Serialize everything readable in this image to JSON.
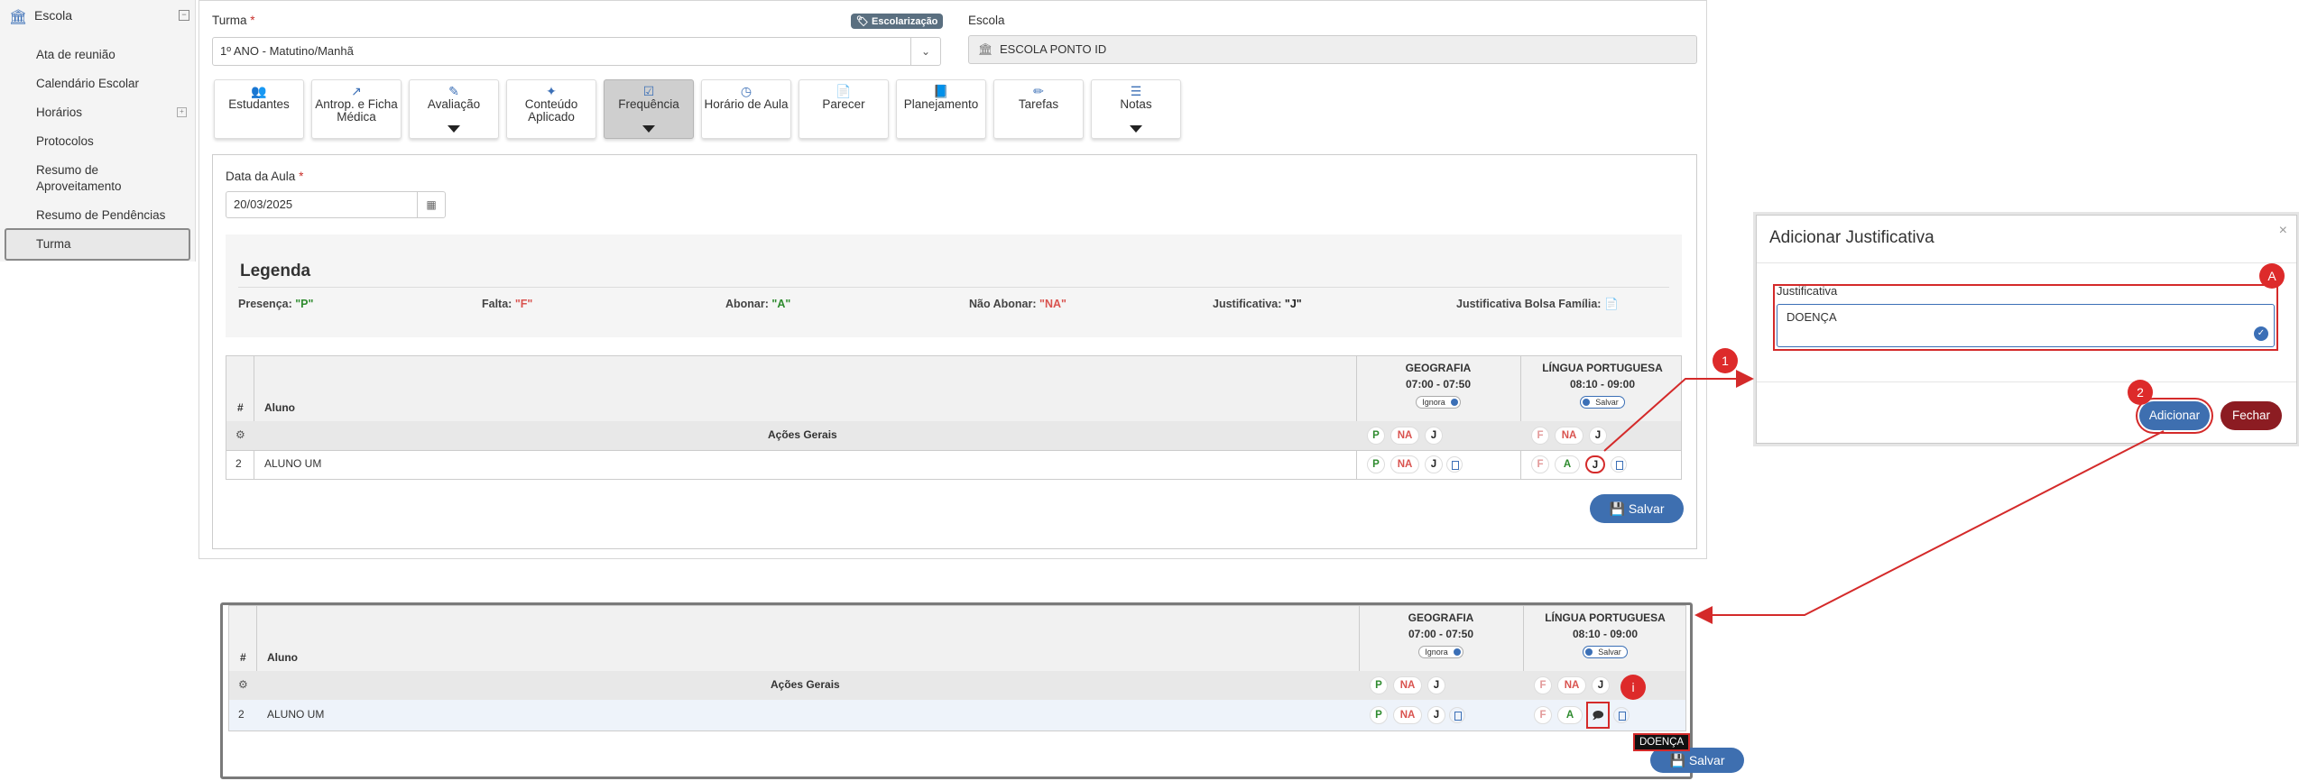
{
  "sidebar": {
    "title": "Escola",
    "items": [
      {
        "label": "Ata de reunião"
      },
      {
        "label": "Calendário Escolar"
      },
      {
        "label": "Horários"
      },
      {
        "label": "Protocolos"
      },
      {
        "label": "Resumo de Aproveitamento"
      },
      {
        "label": "Resumo de Pendências"
      },
      {
        "label": "Turma"
      }
    ]
  },
  "form": {
    "turma_label": "Turma",
    "turma_value": "1º ANO - Matutino/Manhã",
    "badge": "Escolarização",
    "escola_label": "Escola",
    "escola_value": "ESCOLA PONTO ID",
    "data_label": "Data da Aula",
    "data_value": "20/03/2025"
  },
  "tabs": [
    {
      "label": "Estudantes",
      "icon": "users-icon"
    },
    {
      "label": "Antrop. e Ficha Médica",
      "icon": "chart-line-icon"
    },
    {
      "label": "Avaliação",
      "icon": "edit-icon"
    },
    {
      "label": "Conteúdo Aplicado",
      "icon": "magic-wand-icon"
    },
    {
      "label": "Frequência",
      "icon": "check-square-icon"
    },
    {
      "label": "Horário de Aula",
      "icon": "clock-icon"
    },
    {
      "label": "Parecer",
      "icon": "file-icon"
    },
    {
      "label": "Planejamento",
      "icon": "book-icon"
    },
    {
      "label": "Tarefas",
      "icon": "pencil-icon"
    },
    {
      "label": "Notas",
      "icon": "list-icon"
    }
  ],
  "legend": {
    "title": "Legenda",
    "presenca": "Presença:",
    "presenca_code": "\"P\"",
    "falta": "Falta:",
    "falta_code": "\"F\"",
    "abonar": "Abonar:",
    "abonar_code": "\"A\"",
    "nao_abonar": "Não Abonar:",
    "nao_abonar_code": "\"NA\"",
    "justificativa": "Justificativa:",
    "justificativa_code": "\"J\"",
    "bolsa": "Justificativa Bolsa Família:"
  },
  "table": {
    "col_num": "#",
    "col_aluno": "Aluno",
    "subject1": "GEOGRAFIA",
    "time1": "07:00 - 07:50",
    "toggle1": "Ignora",
    "subject2": "LÍNGUA PORTUGUESA",
    "time2": "08:10 - 09:00",
    "toggle2": "Salvar",
    "acoes": "Ações Gerais",
    "row_num": "2",
    "row_name": "ALUNO UM",
    "p": "P",
    "na": "NA",
    "j": "J",
    "f": "F",
    "a": "A"
  },
  "save_button": "Salvar",
  "modal": {
    "title": "Adicionar Justificativa",
    "field_label": "Justificativa",
    "field_value": "DOENÇA",
    "add_button": "Adicionar",
    "close_button": "Fechar"
  },
  "tooltip": "DOENÇA",
  "markers": {
    "m1": "1",
    "m2": "2",
    "mA": "A",
    "mi": "i"
  }
}
